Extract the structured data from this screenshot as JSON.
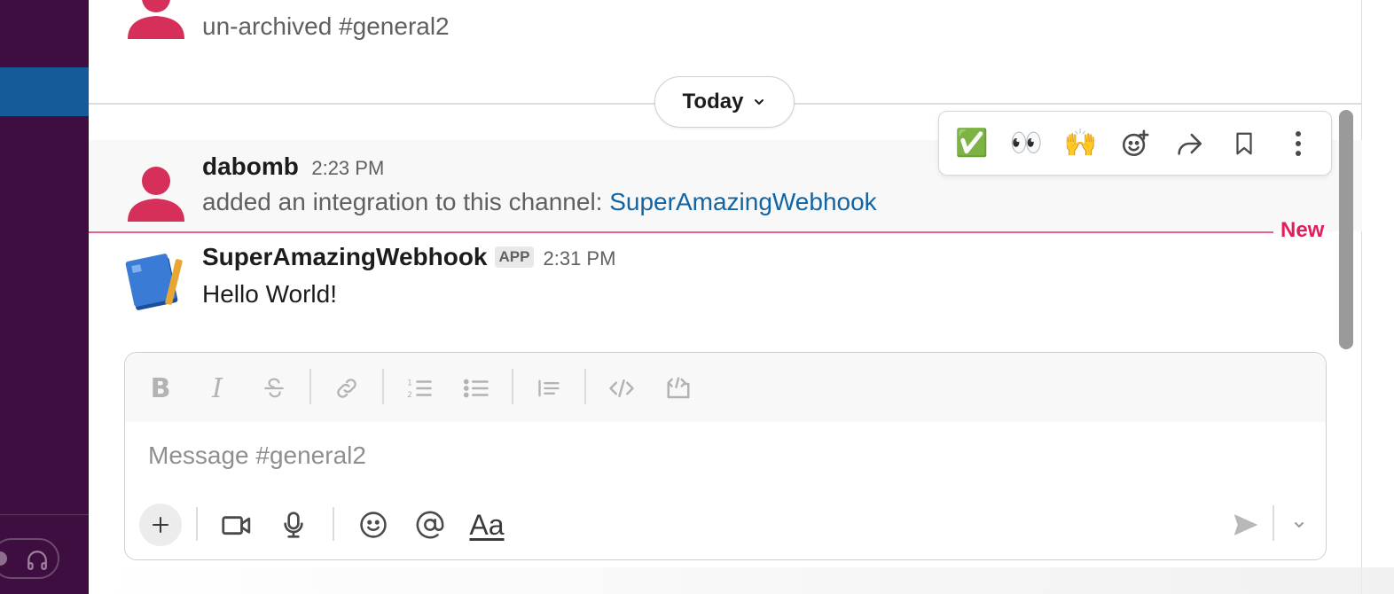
{
  "channel": "#general2",
  "messages": [
    {
      "text": "un-archived #general2"
    },
    {
      "author": "dabomb",
      "time": "2:23 PM",
      "text_prefix": "added an integration to this channel: ",
      "link_text": "SuperAmazingWebhook"
    },
    {
      "author": "SuperAmazingWebhook",
      "badge": "APP",
      "time": "2:31 PM",
      "text": "Hello World!"
    }
  ],
  "day_divider": {
    "label": "Today"
  },
  "new_divider": {
    "label": "New"
  },
  "message_actions": [
    {
      "name": "white-check-mark",
      "glyph": "✅"
    },
    {
      "name": "eyes",
      "glyph": "👀"
    },
    {
      "name": "raised-hands",
      "glyph": "🙌"
    },
    {
      "name": "add-reaction-icon"
    },
    {
      "name": "forward-icon"
    },
    {
      "name": "bookmark-icon"
    },
    {
      "name": "more-actions-icon"
    }
  ],
  "composer": {
    "placeholder": "Message #general2",
    "format_buttons": [
      "bold",
      "italic",
      "strikethrough",
      "link",
      "ordered-list",
      "bulleted-list",
      "blockquote",
      "code",
      "code-block"
    ],
    "bold_glyph": "B",
    "italic_glyph": "I",
    "text_format_glyph": "Aa"
  },
  "colors": {
    "sidebar": "#3f0e40",
    "active_item": "#1164a3",
    "new_divider": "#e01e5a",
    "link": "#1264a3",
    "avatar": "#d6305a"
  }
}
